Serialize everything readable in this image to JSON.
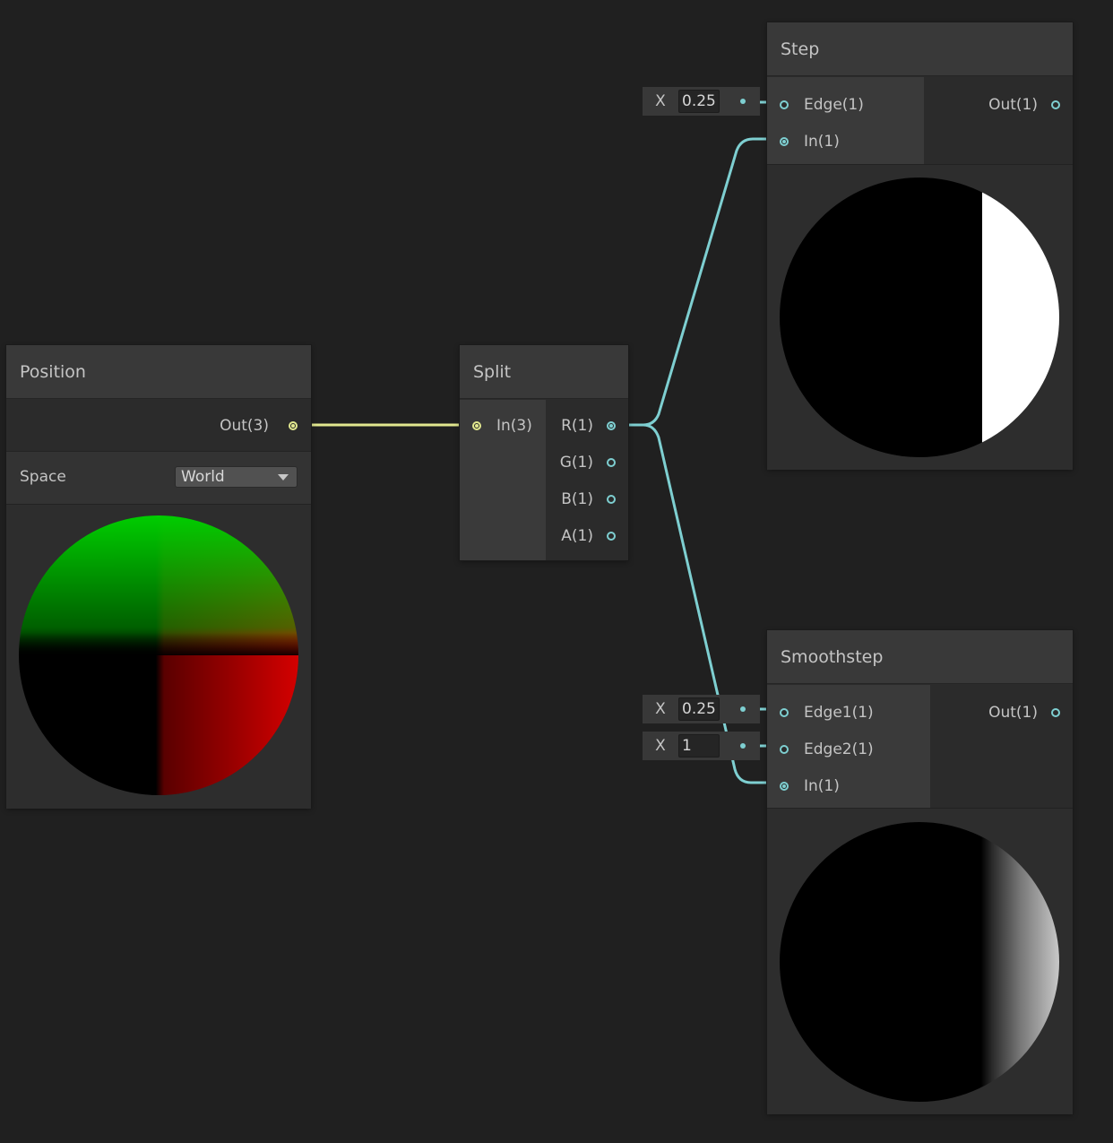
{
  "colors": {
    "background": "#202020",
    "wire_vector3": "#e2e88f",
    "wire_float": "#7ecfd1"
  },
  "nodes": {
    "position": {
      "title": "Position",
      "output_label": "Out(3)",
      "space_label": "Space",
      "space_value": "World"
    },
    "split": {
      "title": "Split",
      "input_label": "In(3)",
      "outputs": [
        "R(1)",
        "G(1)",
        "B(1)",
        "A(1)"
      ]
    },
    "step": {
      "title": "Step",
      "inputs": [
        "Edge(1)",
        "In(1)"
      ],
      "output_label": "Out(1)",
      "edge_field": {
        "label": "X",
        "value": "0.25"
      }
    },
    "smoothstep": {
      "title": "Smoothstep",
      "inputs": [
        "Edge1(1)",
        "Edge2(1)",
        "In(1)"
      ],
      "output_label": "Out(1)",
      "edge1_field": {
        "label": "X",
        "value": "0.25"
      },
      "edge2_field": {
        "label": "X",
        "value": "1"
      }
    }
  }
}
